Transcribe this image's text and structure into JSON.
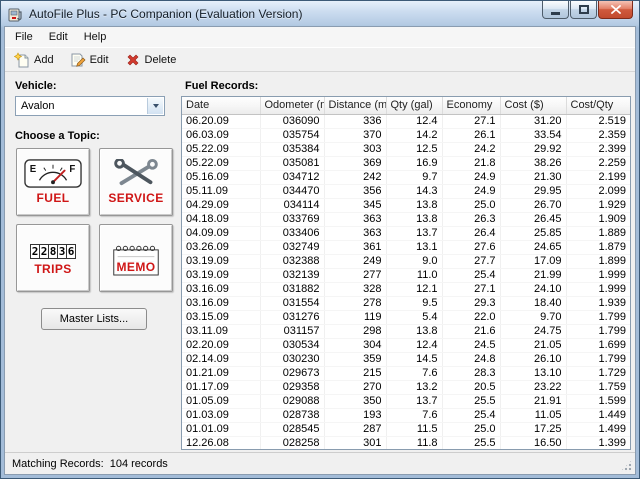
{
  "window": {
    "title": "AutoFile Plus - PC Companion (Evaluation Version)"
  },
  "menu": {
    "items": [
      "File",
      "Edit",
      "Help"
    ]
  },
  "toolbar": {
    "buttons": [
      {
        "label": "Add",
        "icon": "add-icon"
      },
      {
        "label": "Edit",
        "icon": "edit-icon"
      },
      {
        "label": "Delete",
        "icon": "delete-icon"
      }
    ]
  },
  "sidebar": {
    "vehicle_label": "Vehicle:",
    "vehicle_value": "Avalon",
    "topic_label": "Choose a Topic:",
    "topics": [
      {
        "label": "FUEL",
        "icon": "fuel-gauge-icon"
      },
      {
        "label": "SERVICE",
        "icon": "wrench-icon"
      },
      {
        "label": "TRIPS",
        "icon": "odometer-icon",
        "odometer": "22836"
      },
      {
        "label": "MEMO",
        "icon": "notepad-icon"
      }
    ],
    "master_lists_label": "Master Lists..."
  },
  "records": {
    "title": "Fuel Records:",
    "columns": [
      "Date",
      "Odometer (mi)",
      "Distance (mi)",
      "Qty (gal)",
      "Economy",
      "Cost ($)",
      "Cost/Qty"
    ],
    "rows": [
      [
        "06.20.09",
        "036090",
        "336",
        "12.4",
        "27.1",
        "31.20",
        "2.519"
      ],
      [
        "06.03.09",
        "035754",
        "370",
        "14.2",
        "26.1",
        "33.54",
        "2.359"
      ],
      [
        "05.22.09",
        "035384",
        "303",
        "12.5",
        "24.2",
        "29.92",
        "2.399"
      ],
      [
        "05.22.09",
        "035081",
        "369",
        "16.9",
        "21.8",
        "38.26",
        "2.259"
      ],
      [
        "05.16.09",
        "034712",
        "242",
        "9.7",
        "24.9",
        "21.30",
        "2.199"
      ],
      [
        "05.11.09",
        "034470",
        "356",
        "14.3",
        "24.9",
        "29.95",
        "2.099"
      ],
      [
        "04.29.09",
        "034114",
        "345",
        "13.8",
        "25.0",
        "26.70",
        "1.929"
      ],
      [
        "04.18.09",
        "033769",
        "363",
        "13.8",
        "26.3",
        "26.45",
        "1.909"
      ],
      [
        "04.09.09",
        "033406",
        "363",
        "13.7",
        "26.4",
        "25.85",
        "1.889"
      ],
      [
        "03.26.09",
        "032749",
        "361",
        "13.1",
        "27.6",
        "24.65",
        "1.879"
      ],
      [
        "03.19.09",
        "032388",
        "249",
        "9.0",
        "27.7",
        "17.09",
        "1.899"
      ],
      [
        "03.19.09",
        "032139",
        "277",
        "11.0",
        "25.4",
        "21.99",
        "1.999"
      ],
      [
        "03.16.09",
        "031882",
        "328",
        "12.1",
        "27.1",
        "24.10",
        "1.999"
      ],
      [
        "03.16.09",
        "031554",
        "278",
        "9.5",
        "29.3",
        "18.40",
        "1.939"
      ],
      [
        "03.15.09",
        "031276",
        "119",
        "5.4",
        "22.0",
        "9.70",
        "1.799"
      ],
      [
        "03.11.09",
        "031157",
        "298",
        "13.8",
        "21.6",
        "24.75",
        "1.799"
      ],
      [
        "02.20.09",
        "030534",
        "304",
        "12.4",
        "24.5",
        "21.05",
        "1.699"
      ],
      [
        "02.14.09",
        "030230",
        "359",
        "14.5",
        "24.8",
        "26.10",
        "1.799"
      ],
      [
        "01.21.09",
        "029673",
        "215",
        "7.6",
        "28.3",
        "13.10",
        "1.729"
      ],
      [
        "01.17.09",
        "029358",
        "270",
        "13.2",
        "20.5",
        "23.22",
        "1.759"
      ],
      [
        "01.05.09",
        "029088",
        "350",
        "13.7",
        "25.5",
        "21.91",
        "1.599"
      ],
      [
        "01.03.09",
        "028738",
        "193",
        "7.6",
        "25.4",
        "11.05",
        "1.449"
      ],
      [
        "01.01.09",
        "028545",
        "287",
        "11.5",
        "25.0",
        "17.25",
        "1.499"
      ],
      [
        "12.26.08",
        "028258",
        "301",
        "11.8",
        "25.5",
        "16.50",
        "1.399"
      ]
    ]
  },
  "statusbar": {
    "label": "Matching Records:",
    "value": "104 records"
  },
  "colors": {
    "accent_red": "#cf1616",
    "close_button_red": "#c14a2e",
    "title_gradient_top": "#e6f0fb",
    "title_gradient_bottom": "#a3bcd8"
  }
}
